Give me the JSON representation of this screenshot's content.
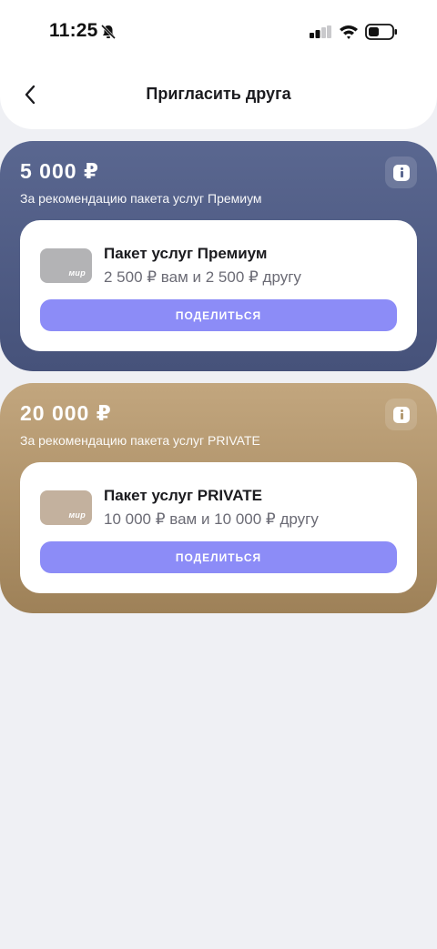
{
  "status_bar": {
    "time": "11:25"
  },
  "header": {
    "title": "Пригласить друга"
  },
  "offers": [
    {
      "amount": "5 000 ₽",
      "subtitle": "За рекомендацию пакета услуг Премиум",
      "package_title": "Пакет услуг Премиум",
      "package_desc": "2 500 ₽ вам и 2 500 ₽ другу",
      "card_logo": "мир",
      "share_label": "ПОДЕЛИТЬСЯ",
      "gradient_top": "#5a6790",
      "gradient_bottom": "#46527a"
    },
    {
      "amount": "20 000 ₽",
      "subtitle": "За рекомендацию пакета услуг PRIVATE",
      "package_title": "Пакет услуг PRIVATE",
      "package_desc": "10 000 ₽ вам и 10 000 ₽ другу",
      "card_logo": "мир",
      "share_label": "ПОДЕЛИТЬСЯ",
      "gradient_top": "#c2a67e",
      "gradient_bottom": "#9e8158"
    }
  ],
  "colors": {
    "background": "#eff0f4",
    "accent_button": "#8c8cf7"
  },
  "icons": {
    "back": "chevron-left-icon",
    "info": "info-icon",
    "bell": "bell-off-icon",
    "signal": "signal-icon",
    "wifi": "wifi-icon",
    "battery": "battery-icon"
  }
}
